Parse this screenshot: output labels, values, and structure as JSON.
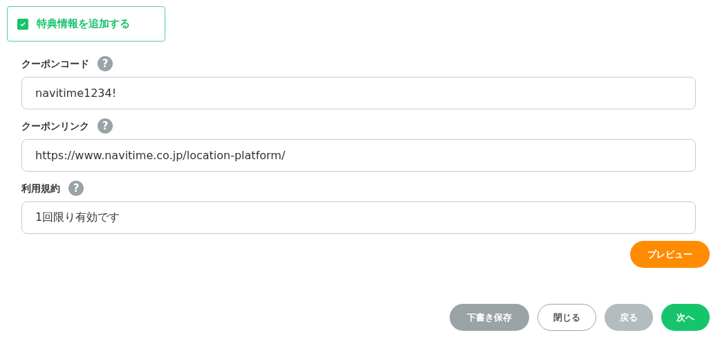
{
  "benefit_toggle": {
    "label": "特典情報を追加する",
    "checked": true
  },
  "fields": [
    {
      "label": "クーポンコード",
      "help": "?",
      "value": "navitime1234!"
    },
    {
      "label": "クーポンリンク",
      "help": "?",
      "value": "https://www.navitime.co.jp/location-platform/"
    },
    {
      "label": "利用規約",
      "help": "?",
      "value": "1回限り有効です"
    }
  ],
  "preview_button": "プレビュー",
  "buttons": [
    {
      "label": "下書き保存",
      "kind": "draft",
      "disabled": false
    },
    {
      "label": "閉じる",
      "kind": "outline",
      "disabled": false
    },
    {
      "label": "戻る",
      "kind": "back",
      "disabled": true
    },
    {
      "label": "次へ",
      "kind": "primary",
      "disabled": false
    }
  ]
}
